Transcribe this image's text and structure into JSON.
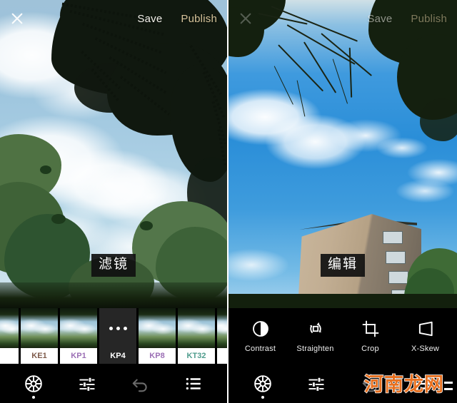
{
  "app": {
    "panels": [
      {
        "id": "filter-panel",
        "caption": "滤镜",
        "topbar": {
          "close_icon": "close-icon",
          "save_label": "Save",
          "publish_label": "Publish"
        }
      },
      {
        "id": "edit-panel",
        "caption": "编辑",
        "topbar": {
          "close_icon": "close-icon",
          "save_label": "Save",
          "publish_label": "Publish"
        }
      }
    ]
  },
  "filter_strip": {
    "items": [
      {
        "name": "partial-left",
        "label": "",
        "selected": false,
        "label_color": "#8b6f5c"
      },
      {
        "name": "KE1",
        "label": "KE1",
        "selected": false,
        "label_color": "#7d5a4a"
      },
      {
        "name": "KP1",
        "label": "KP1",
        "selected": false,
        "label_color": "#9b6fb5"
      },
      {
        "name": "KP4",
        "label": "KP4",
        "selected": true,
        "label_color": "#ffffff"
      },
      {
        "name": "KP8",
        "label": "KP8",
        "selected": false,
        "label_color": "#9b6fb5"
      },
      {
        "name": "KT32",
        "label": "KT32",
        "selected": false,
        "label_color": "#4f9c8d"
      },
      {
        "name": "partial-right",
        "label": "",
        "selected": false,
        "label_color": "#3f8fb0"
      }
    ],
    "selected_marker": "three-dots"
  },
  "edit_tools": [
    {
      "label": "Contrast",
      "icon": "contrast-icon"
    },
    {
      "label": "Straighten",
      "icon": "straighten-icon"
    },
    {
      "label": "Crop",
      "icon": "crop-icon"
    },
    {
      "label": "X-Skew",
      "icon": "x-skew-icon"
    }
  ],
  "bottom_nav_left": [
    {
      "icon": "filter-wheel-icon",
      "active": true,
      "dot": true
    },
    {
      "icon": "adjust-sliders-icon",
      "active": false,
      "dot": false
    },
    {
      "icon": "undo-icon",
      "active": false,
      "dot": false
    },
    {
      "icon": "list-icon",
      "active": false,
      "dot": false
    }
  ],
  "bottom_nav_right": [
    {
      "icon": "filter-wheel-icon",
      "active": true,
      "dot": true
    },
    {
      "icon": "adjust-sliders-icon",
      "active": false,
      "dot": false
    },
    {
      "icon": "undo-icon",
      "active": false,
      "dot": false
    },
    {
      "icon": "list-icon",
      "active": false,
      "dot": false
    }
  ],
  "watermark": {
    "text": "河南龙网",
    "color": "#e8701f",
    "outline": "#ffffff"
  },
  "colors": {
    "background": "#000000",
    "save_text": "#f2f0ea",
    "publish_text": "#d6c39a",
    "caption_bg": "#101010",
    "selected_filter_bg": "#262626",
    "watermark": "#e8701f"
  }
}
